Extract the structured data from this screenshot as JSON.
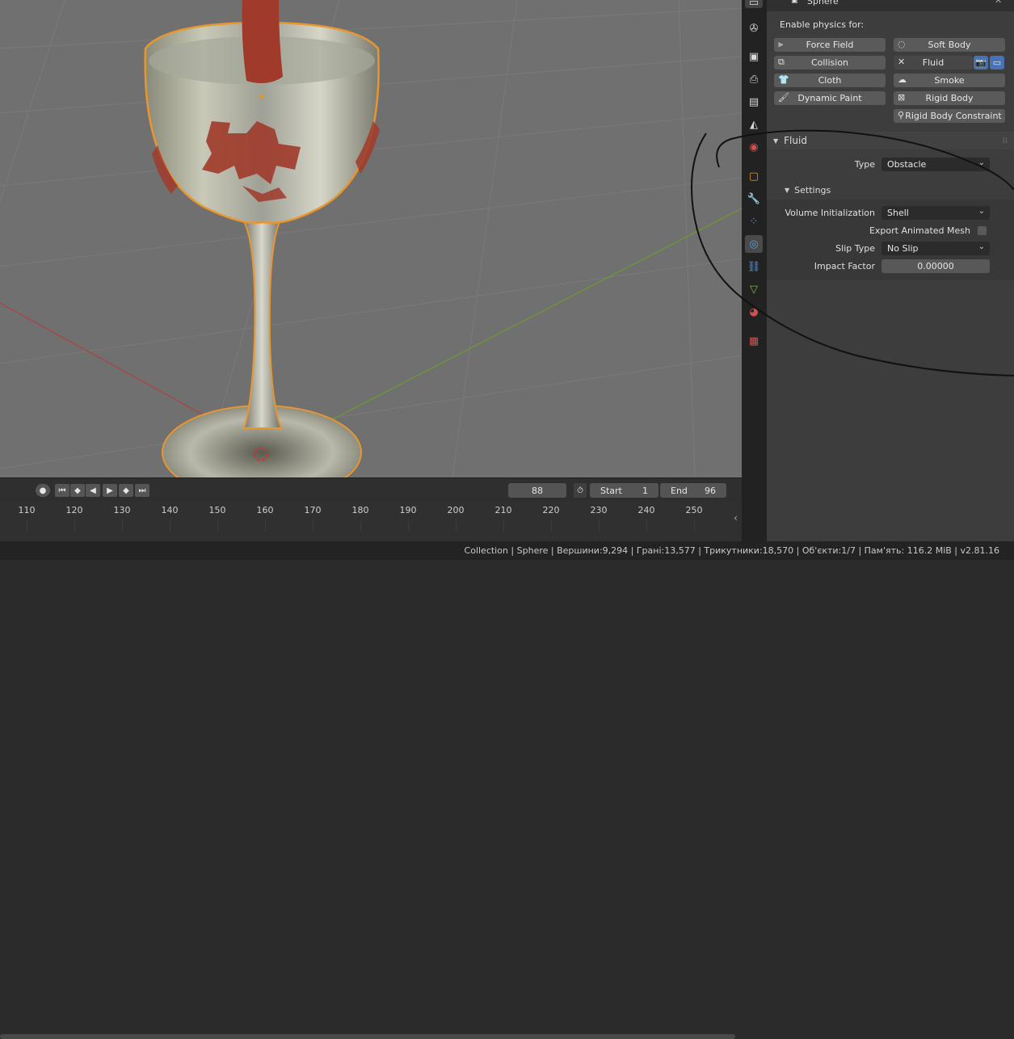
{
  "object_name": "Sphere",
  "physics": {
    "heading": "Enable physics for:",
    "buttons": [
      {
        "label": "Force Field",
        "icon": "force-field-icon"
      },
      {
        "label": "Soft Body",
        "icon": "soft-body-icon"
      },
      {
        "label": "Collision",
        "icon": "collision-icon"
      },
      {
        "label": "Fluid",
        "icon": "close-icon"
      },
      {
        "label": "Cloth",
        "icon": "cloth-icon"
      },
      {
        "label": "Smoke",
        "icon": "smoke-icon"
      },
      {
        "label": "Dynamic Paint",
        "icon": "dynamic-paint-icon"
      },
      {
        "label": "Rigid Body",
        "icon": "rigid-body-icon"
      },
      {
        "label": "Rigid Body Constraint",
        "icon": "rigid-body-constraint-icon"
      }
    ]
  },
  "fluid_panel": {
    "title": "Fluid",
    "type_label": "Type",
    "type_value": "Obstacle",
    "settings_title": "Settings",
    "volume_init_label": "Volume Initialization",
    "volume_init_value": "Shell",
    "export_mesh_label": "Export Animated Mesh",
    "export_mesh_checked": false,
    "slip_type_label": "Slip Type",
    "slip_type_value": "No Slip",
    "impact_factor_label": "Impact Factor",
    "impact_factor_value": "0.00000"
  },
  "timeline": {
    "current_frame": "88",
    "start_label": "Start",
    "start_value": "1",
    "end_label": "End",
    "end_value": "96",
    "ticks": [
      "110",
      "120",
      "130",
      "140",
      "150",
      "160",
      "170",
      "180",
      "190",
      "200",
      "210",
      "220",
      "230",
      "240",
      "250"
    ]
  },
  "statusbar": {
    "text": "Collection | Sphere | Вершини:9,294 | Грані:13,577 | Трикутники:18,570 | Об'єкти:1/7 | Пам'ять: 116.2 MiB | v2.81.16"
  },
  "colors": {
    "viewport": "#707070",
    "panel": "#3d3d3d",
    "selection_outline": "#e8962e",
    "wine": "#a03a2a",
    "active_toggle": "#4772b3"
  }
}
